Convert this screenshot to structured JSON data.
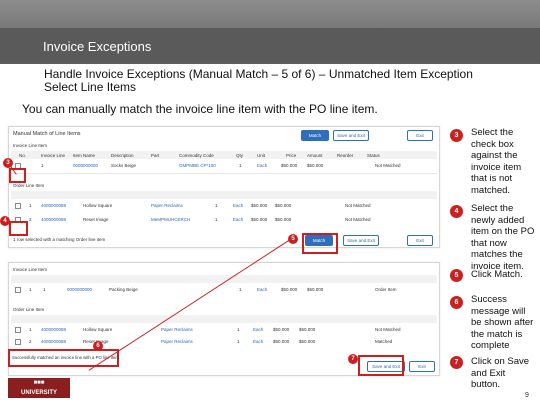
{
  "slide": {
    "title": "Invoice Exceptions",
    "subtitle_line1": "Handle Invoice Exceptions (Manual Match – 5 of 6) – Unmatched Item Exception",
    "subtitle_line2": "Select Line Items",
    "instruction": "You can manually match the invoice line item with the PO line item.",
    "page_number": "9",
    "logo_text": "UNIVERSITY"
  },
  "screen1": {
    "dialog_title": "Manual Match of Line Items",
    "buttons": {
      "match": "Match",
      "save_and_exit": "Save and Exit",
      "exit": "Exit"
    },
    "invoice_section": "Invoice Line Item",
    "invoice_columns": [
      "No.",
      "Invoice Line",
      "Item Name",
      "Description",
      "Part",
      "Commodity Code",
      "Qty",
      "Unit",
      "Price",
      "Amount",
      "Reorder",
      "Status"
    ],
    "invoice_row": [
      "1",
      "1",
      "0000000000",
      "Socks Beige",
      "GMPMBE CP*100",
      "1",
      "Each",
      "$50.000",
      "$50.000",
      "Not Matched"
    ],
    "order_section": "Order Line Item",
    "order_rows": [
      [
        "1",
        "4000000088",
        "Hollow Square",
        "Paper Reclaims",
        "1",
        "Each",
        "$50.000",
        "$50.000",
        "Not Matched"
      ],
      [
        "2",
        "4000000088",
        "Reset Image",
        "MeMPMUHCERCH",
        "1",
        "Each",
        "$50.000",
        "$50.000",
        "Not Matched"
      ]
    ],
    "footer_text": "1 row selected with a matching Order line item",
    "match_button": "Match",
    "save_exit_button": "Save and Exit",
    "exit_button": "Exit"
  },
  "screen2": {
    "invoice_section": "Invoice Line Item",
    "invoice_row": [
      "1",
      "1",
      "0000000000",
      "Packing Beige",
      "1",
      "Each",
      "$50.000",
      "$50.000",
      "Order Item"
    ],
    "order_section": "Order Line Item",
    "order_rows": [
      [
        "1",
        "4000000088",
        "Hollow Square",
        "Paper Reclaims",
        "1",
        "Each",
        "$50.000",
        "$50.000",
        "Not Matched"
      ],
      [
        "2",
        "4000000088",
        "Reset Image",
        "Paper Reclaims",
        "1",
        "Each",
        "$50.000",
        "$50.000",
        "Matched"
      ]
    ],
    "success_message": "Successfully matched an invoice line with a PO line item.",
    "save_exit_button": "Save and Exit",
    "exit_button": "Exit"
  },
  "callouts": {
    "c3": "3",
    "c4": "4",
    "c5": "5",
    "c6": "6",
    "c7": "7"
  },
  "steps": [
    {
      "num": "3",
      "text": "Select the check box against the invoice item that is not matched."
    },
    {
      "num": "4",
      "text": "Select the newly added item on the PO that now matches the invoice item."
    },
    {
      "num": "5",
      "text": "Click Match."
    },
    {
      "num": "6",
      "text": "Success message will be shown after the match is complete"
    },
    {
      "num": "7",
      "text": "Click on Save and Exit button."
    }
  ],
  "colors": {
    "accent_red": "#cc1f1f",
    "header_gray": "#5a5a5a",
    "link_blue": "#2b66b8"
  }
}
